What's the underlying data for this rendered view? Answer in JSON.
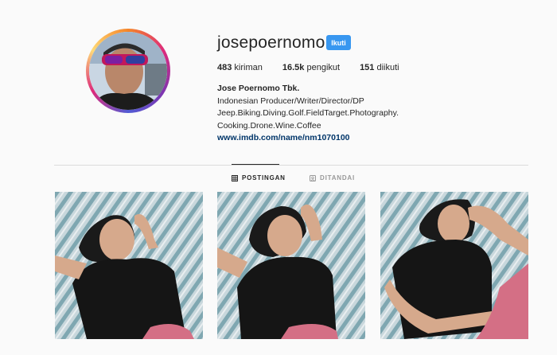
{
  "profile": {
    "username": "josepoernomo",
    "follow_label": "Ikuti",
    "stats": {
      "posts_count": "483",
      "posts_label": "kiriman",
      "followers_count": "16.5k",
      "followers_label": "pengikut",
      "following_count": "151",
      "following_label": "diikuti"
    },
    "bio": {
      "full_name": "Jose Poernomo Tbk.",
      "line1": "Indonesian Producer/Writer/Director/DP",
      "line2": "Jeep.Biking.Diving.Golf.FieldTarget.Photography.",
      "line3": "Cooking.Drone.Wine.Coffee",
      "link": "www.imdb.com/name/nm1070100"
    }
  },
  "tabs": [
    {
      "label": "POSTINGAN",
      "icon": "grid-icon",
      "active": true
    },
    {
      "label": "DITANDAI",
      "icon": "tag-icon",
      "active": false
    }
  ],
  "colors": {
    "follow_button": "#3897f0",
    "link": "#003569",
    "divider": "#dbdbdb"
  }
}
